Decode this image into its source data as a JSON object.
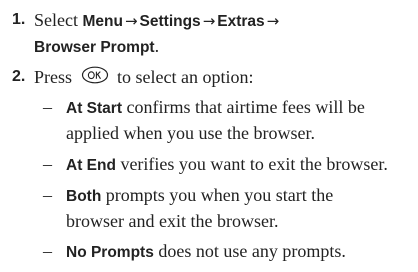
{
  "steps": [
    {
      "number": "1.",
      "text_select": "Select ",
      "menu": "Menu",
      "arrow": "→",
      "settings": "Settings",
      "extras": "Extras",
      "browser_prompt": "Browser Prompt",
      "period": "."
    },
    {
      "number": "2.",
      "press": "Press",
      "ok_key_icon": "ok-key-icon",
      "rest": "to select an option:"
    }
  ],
  "options": [
    {
      "dash": "–",
      "name": "At Start",
      "line1": " confirms that airtime fees will be",
      "line2": "applied when you use the browser."
    },
    {
      "dash": "–",
      "name": "At End",
      "line1": " verifies you want to exit the browser."
    },
    {
      "dash": "–",
      "name": "Both",
      "line1": " prompts you when you start the",
      "line2": "browser and exit the browser."
    },
    {
      "dash": "–",
      "name": "No Prompts",
      "line1": " does not use any prompts."
    }
  ]
}
